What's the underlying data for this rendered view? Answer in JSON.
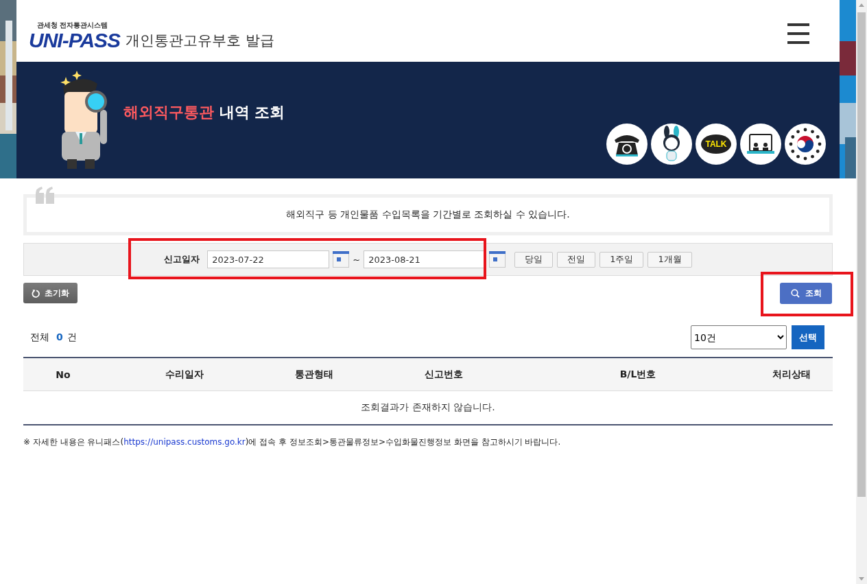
{
  "header": {
    "logo": {
      "caption": "관세청 전자통관시스템",
      "wordmark": "UNI-PASS"
    },
    "title": "개인통관고유부호 발급"
  },
  "banner": {
    "title_highlight": "해외직구통관",
    "title_rest": "내역 조회",
    "quick_links": [
      {
        "kind": "phone"
      },
      {
        "kind": "mascot"
      },
      {
        "kind": "talk",
        "label": "TALK"
      },
      {
        "kind": "video"
      },
      {
        "kind": "emblem"
      }
    ]
  },
  "notice": "해외직구 등 개인물품 수입목록을 기간별로 조회하실 수 있습니다.",
  "search": {
    "label": "신고일자",
    "from": "2023-07-22",
    "separator": "~",
    "to": "2023-08-21",
    "periods": [
      "당일",
      "전일",
      "1주일",
      "1개월"
    ],
    "reset_button": "초기화",
    "search_button": "조회"
  },
  "results": {
    "total_label": "전체",
    "count": "0",
    "unit": "건",
    "page_size": "10건",
    "apply_button": "선택",
    "columns": [
      "No",
      "수리일자",
      "통관형태",
      "신고번호",
      "B/L번호",
      "처리상태"
    ],
    "empty_message": "조회결과가 존재하지 않습니다."
  },
  "footnote": {
    "before": "※ 자세한 내용은 유니패스(",
    "link": "https://unipass.customs.go.kr",
    "after": ")에 접속 후 정보조회>통관물류정보>수입화물진행정보 화면을 참고하시기 바랍니다."
  }
}
